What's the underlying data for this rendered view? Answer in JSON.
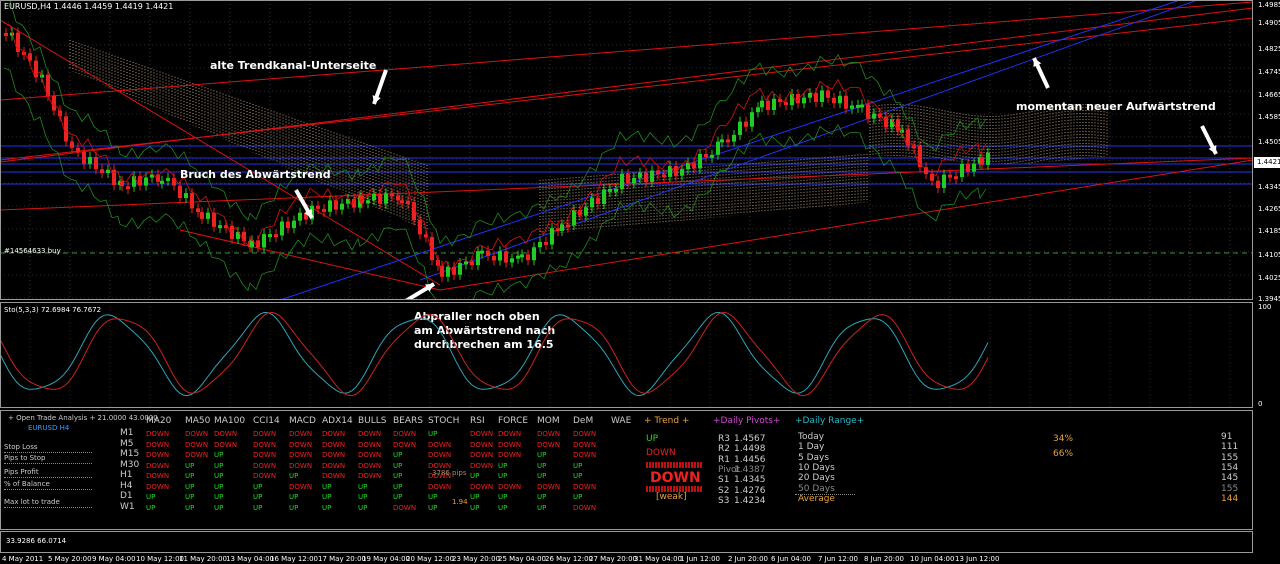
{
  "chart_header": "EURUSD,H4  1.4446 1.4459 1.4419 1.4421",
  "current_price": "1.4421",
  "order_label": "#14564633 buy",
  "stoch_label": "Sto(5,3,3) 72.6984 76.7672",
  "stoch_scale": {
    "top": "100",
    "bottom": "0"
  },
  "price_scale": [
    "1.4985",
    "1.4905",
    "1.4825",
    "1.4745",
    "1.4665",
    "1.4585",
    "1.4505",
    "1.4345",
    "1.4265",
    "1.4185",
    "1.4105",
    "1.4025",
    "1.3945"
  ],
  "annotations": {
    "upper_side": "alte Trendkanal-Unterseite",
    "new_trend": "momentan neuer Aufwärtstrend",
    "break": "Bruch des Abwärtstrend",
    "bounce_1": "Abpraller noch oben",
    "bounce_2": "am Abwärtstrend nach",
    "bounce_3": "durchbrechen am 16.5"
  },
  "time_axis": [
    "4 May 2011",
    "5 May 20:00",
    "9 May 04:00",
    "10 May 12:00",
    "11 May 20:00",
    "13 May 04:00",
    "16 May 12:00",
    "17 May 20:00",
    "19 May 04:00",
    "20 May 12:00",
    "23 May 20:00",
    "25 May 04:00",
    "26 May 12:00",
    "27 May 20:00",
    "31 May 04:00",
    "1 Jun 12:00",
    "2 Jun 20:00",
    "6 Jun 04:00",
    "7 Jun 12:00",
    "8 Jun 20:00",
    "10 Jun 04:00",
    "13 Jun 12:00"
  ],
  "bottom_readout": "33.9286 66.0714",
  "panel": {
    "title": "+ Open Trade Analysis + 21.0000 43.0000",
    "symbol": "EURUSD  H4",
    "left_labels": [
      "Stop Loss",
      "Pips to Stop",
      "Pips Profit",
      "% of Balance",
      "Max lot to trade"
    ],
    "indicators": [
      "MA20",
      "MA50",
      "MA100",
      "CCI14",
      "MACD",
      "ADX14",
      "BULLS",
      "BEARS",
      "STOCH",
      "RSI",
      "FORCE",
      "MOM",
      "DeM",
      "WAE"
    ],
    "timeframes": [
      "M1",
      "M5",
      "M15",
      "M30",
      "H1",
      "H4",
      "D1",
      "W1"
    ],
    "grid": [
      [
        "DOWN",
        "DOWN",
        "DOWN",
        "DOWN",
        "DOWN",
        "DOWN",
        "DOWN",
        "DOWN",
        "UP",
        "DOWN",
        "DOWN",
        "DOWN",
        "DOWN"
      ],
      [
        "DOWN",
        "DOWN",
        "DOWN",
        "DOWN",
        "DOWN",
        "DOWN",
        "DOWN",
        "DOWN",
        "DOWN",
        "DOWN",
        "DOWN",
        "DOWN",
        "DOWN"
      ],
      [
        "DOWN",
        "DOWN",
        "UP",
        "DOWN",
        "DOWN",
        "DOWN",
        "DOWN",
        "UP",
        "DOWN",
        "DOWN",
        "DOWN",
        "UP",
        "DOWN"
      ],
      [
        "DOWN",
        "UP",
        "UP",
        "DOWN",
        "DOWN",
        "DOWN",
        "DOWN",
        "UP",
        "DOWN",
        "DOWN",
        "UP",
        "UP",
        "UP"
      ],
      [
        "DOWN",
        "UP",
        "UP",
        "DOWN",
        "UP",
        "DOWN",
        "DOWN",
        "UP",
        "DOWN",
        "UP",
        "UP",
        "UP",
        "UP"
      ],
      [
        "DOWN",
        "UP",
        "UP",
        "UP",
        "DOWN",
        "UP",
        "UP",
        "UP",
        "DOWN",
        "DOWN",
        "DOWN",
        "DOWN",
        "DOWN"
      ],
      [
        "UP",
        "UP",
        "UP",
        "UP",
        "UP",
        "UP",
        "UP",
        "UP",
        "UP",
        "UP",
        "UP",
        "UP",
        "UP"
      ],
      [
        "UP",
        "UP",
        "UP",
        "UP",
        "UP",
        "UP",
        "UP",
        "DOWN",
        "UP",
        "UP",
        "UP",
        "UP",
        "DOWN"
      ]
    ],
    "pips_text": "3786 pips",
    "overlay_value": "1.94",
    "trend": {
      "header": "+  Trend  +",
      "up": "UP",
      "down": "DOWN",
      "signal": "DOWN",
      "strength": "[weak]"
    },
    "pivots": {
      "header": "+Daily Pivots+",
      "rows": [
        {
          "label": "R3",
          "value": "1.4567"
        },
        {
          "label": "R2",
          "value": "1.4498"
        },
        {
          "label": "R1",
          "value": "1.4456"
        },
        {
          "label": "Pivot",
          "value": "1.4387"
        },
        {
          "label": "S1",
          "value": "1.4345"
        },
        {
          "label": "S2",
          "value": "1.4276"
        },
        {
          "label": "S3",
          "value": "1.4234"
        }
      ]
    },
    "range": {
      "header": "+Daily Range+",
      "rows": [
        {
          "label": "Today",
          "value": "91"
        },
        {
          "label": "1 Day",
          "value": "111"
        },
        {
          "label": "5 Days",
          "value": "155"
        },
        {
          "label": "10 Days",
          "value": "154"
        },
        {
          "label": "20 Days",
          "value": "145"
        },
        {
          "label": "50 Days",
          "value": "155"
        },
        {
          "label": "Average",
          "value": "144"
        }
      ],
      "pct_today": "34%",
      "pct_day": "66%"
    }
  },
  "colors": {
    "bull": "#22cc22",
    "bear": "#ee2222",
    "channel": "#dd1111",
    "blue_line": "#2233ee",
    "band": "#1d8a1d",
    "cloud": "#e0c08a",
    "stoch_main": "#2aa6b8",
    "stoch_signal": "#cc2222"
  }
}
